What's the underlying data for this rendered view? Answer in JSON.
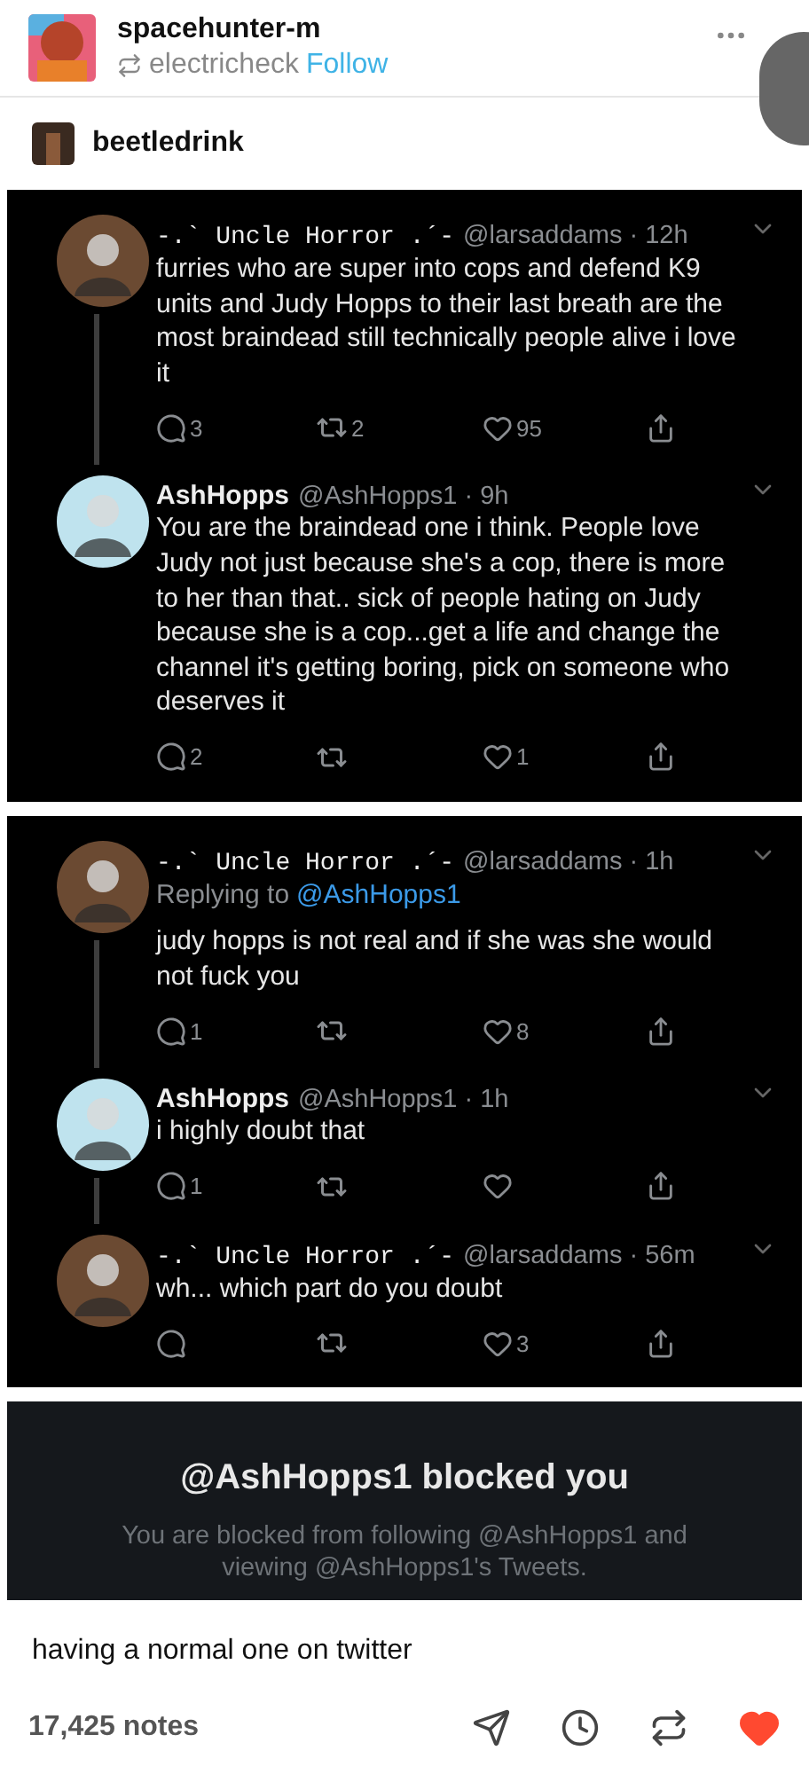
{
  "post": {
    "author": "spacehunter-m",
    "reblogged_from": "electricheck",
    "follow": "Follow"
  },
  "reblog": {
    "username": "beetledrink"
  },
  "screenshots": [
    {
      "tweets": [
        {
          "name": "-.` Uncle Horror .´-",
          "kind": "mono",
          "color": "#6b4a32",
          "meta": "@larsaddams · 12h",
          "text": "furries who are super into cops and defend K9 units and Judy Hopps to their last breath are the most braindead still technically people alive i love it",
          "replies": "3",
          "retweets": "2",
          "likes": "95",
          "thread_continues": true
        },
        {
          "name": "AshHopps",
          "kind": "bold",
          "color": "#bfe3ee",
          "meta": "@AshHopps1 · 9h",
          "text": "You are the braindead one i think. People love Judy not just because she's a cop, there is more to her than that.. sick of people hating on Judy because she is a cop...get a life and change the channel it's getting boring, pick on someone who deserves it",
          "replies": "2",
          "likes": "1",
          "thread_continues": false
        }
      ]
    },
    {
      "tweets": [
        {
          "name": "-.` Uncle Horror .´-",
          "kind": "mono",
          "color": "#6b4a32",
          "meta": "@larsaddams · 1h",
          "replying_label": "Replying to",
          "replying_to": "@AshHopps1",
          "text": "judy hopps is not real and if she was she would not fuck you",
          "replies": "1",
          "likes": "8",
          "thread_continues": true
        },
        {
          "name": "AshHopps",
          "kind": "bold",
          "color": "#bfe3ee",
          "meta": "@AshHopps1 · 1h",
          "text": "i highly doubt that",
          "replies": "1",
          "thread_continues": true
        },
        {
          "name": "-.` Uncle Horror .´-",
          "kind": "mono",
          "color": "#6b4a32",
          "meta": "@larsaddams · 56m",
          "text": "wh... which part do you doubt",
          "likes": "3",
          "thread_continues": false
        }
      ]
    }
  ],
  "blocked": {
    "title": "@AshHopps1 blocked you",
    "message": "You are blocked from following @AshHopps1 and viewing @AshHopps1's Tweets."
  },
  "caption": "having a normal one on twitter",
  "footer": {
    "notes": "17,425 notes",
    "liked": true
  }
}
